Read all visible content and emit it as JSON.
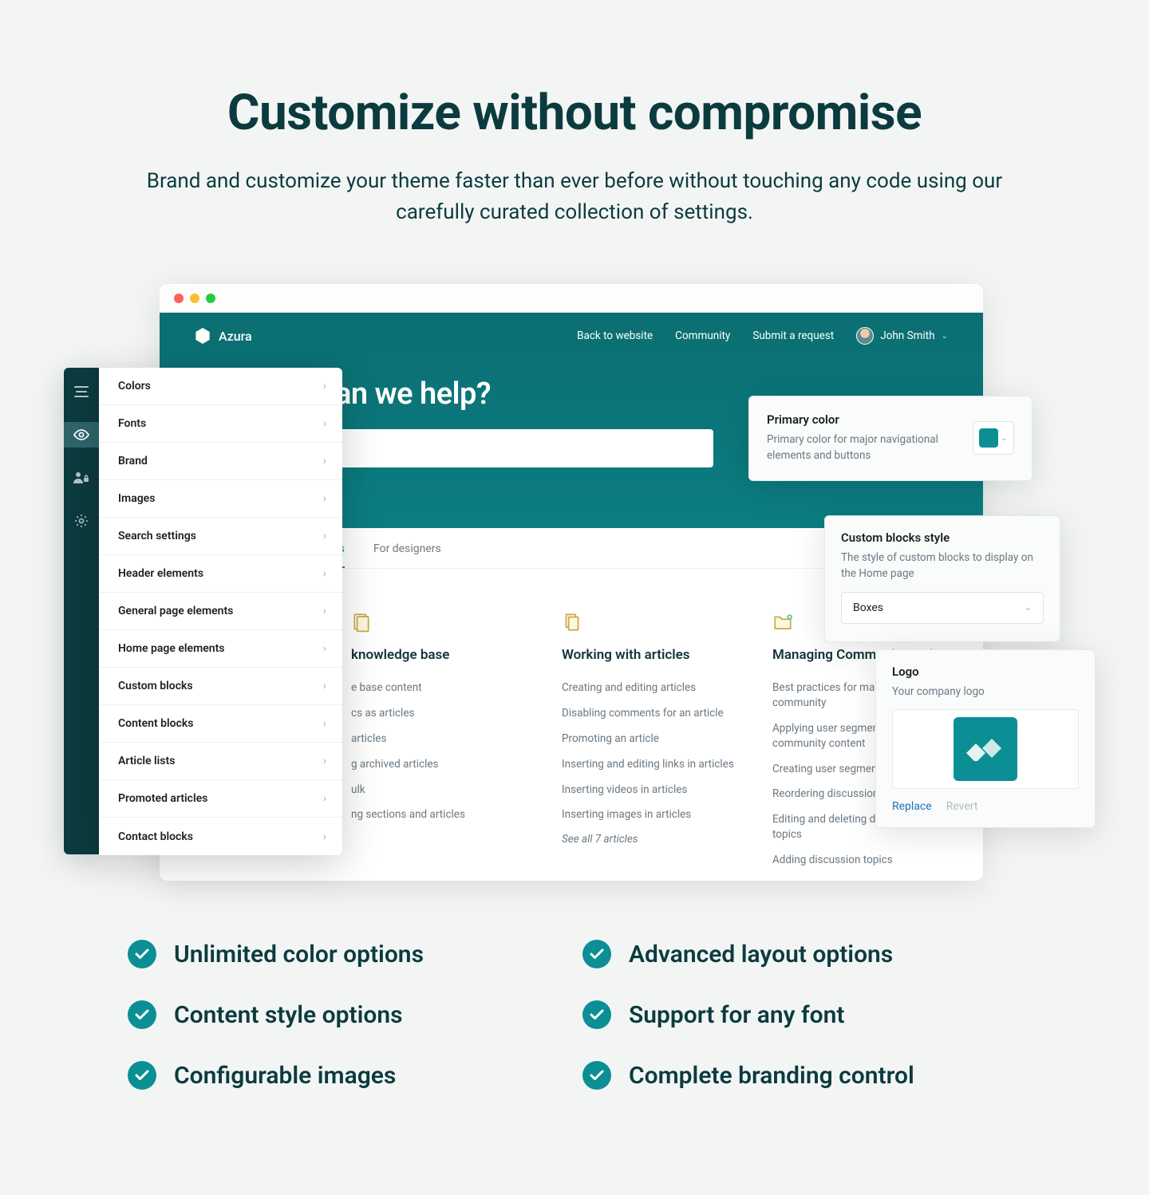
{
  "page": {
    "headline": "Customize without compromise",
    "subhead": "Brand and customize your theme faster than ever before without touching any code using our carefully curated collection of settings."
  },
  "brand": {
    "name": "Azura"
  },
  "nav": {
    "back": "Back to website",
    "community": "Community",
    "submit": "Submit a request",
    "user": "John Smith"
  },
  "hero": {
    "title": "an we help?"
  },
  "tabs": {
    "tab1": "rs",
    "tab2": "For designers"
  },
  "settings": {
    "items": [
      {
        "label": "Colors"
      },
      {
        "label": "Fonts"
      },
      {
        "label": "Brand"
      },
      {
        "label": "Images"
      },
      {
        "label": "Search settings"
      },
      {
        "label": "Header elements"
      },
      {
        "label": "General page elements"
      },
      {
        "label": "Home page elements"
      },
      {
        "label": "Custom blocks"
      },
      {
        "label": "Content blocks"
      },
      {
        "label": "Article lists"
      },
      {
        "label": "Promoted articles"
      },
      {
        "label": "Contact blocks"
      }
    ]
  },
  "columns": {
    "c1": {
      "title": "knowledge base",
      "items": [
        "e base content",
        "cs as articles",
        "articles",
        "g archived articles",
        "ulk",
        "ng sections and articles"
      ]
    },
    "c2": {
      "title": "Working with articles",
      "items": [
        "Creating and editing articles",
        "Disabling comments for an article",
        "Promoting an article",
        "Inserting and editing links in articles",
        "Inserting videos in articles",
        "Inserting images in articles"
      ],
      "see_all": "See all 7 articles"
    },
    "c3": {
      "title": "Managing Community topics",
      "items": [
        "Best practices for managing your community",
        "Applying user segments to community content",
        "Creating user segments",
        "Reordering discussion topics",
        "Editing and deleting discussion topics",
        "Adding discussion topics"
      ]
    }
  },
  "panels": {
    "primary": {
      "title": "Primary color",
      "desc": "Primary color for major navigational elements and buttons",
      "color": "#0b8f94"
    },
    "blocks": {
      "title": "Custom blocks style",
      "desc": "The style of custom blocks to display on the Home page",
      "value": "Boxes"
    },
    "logo": {
      "title": "Logo",
      "desc": "Your company logo",
      "replace": "Replace",
      "revert": "Revert"
    }
  },
  "features": [
    {
      "label": "Unlimited color options"
    },
    {
      "label": "Advanced layout options"
    },
    {
      "label": "Content style options"
    },
    {
      "label": "Support for any font"
    },
    {
      "label": "Configurable images"
    },
    {
      "label": "Complete branding control"
    }
  ]
}
